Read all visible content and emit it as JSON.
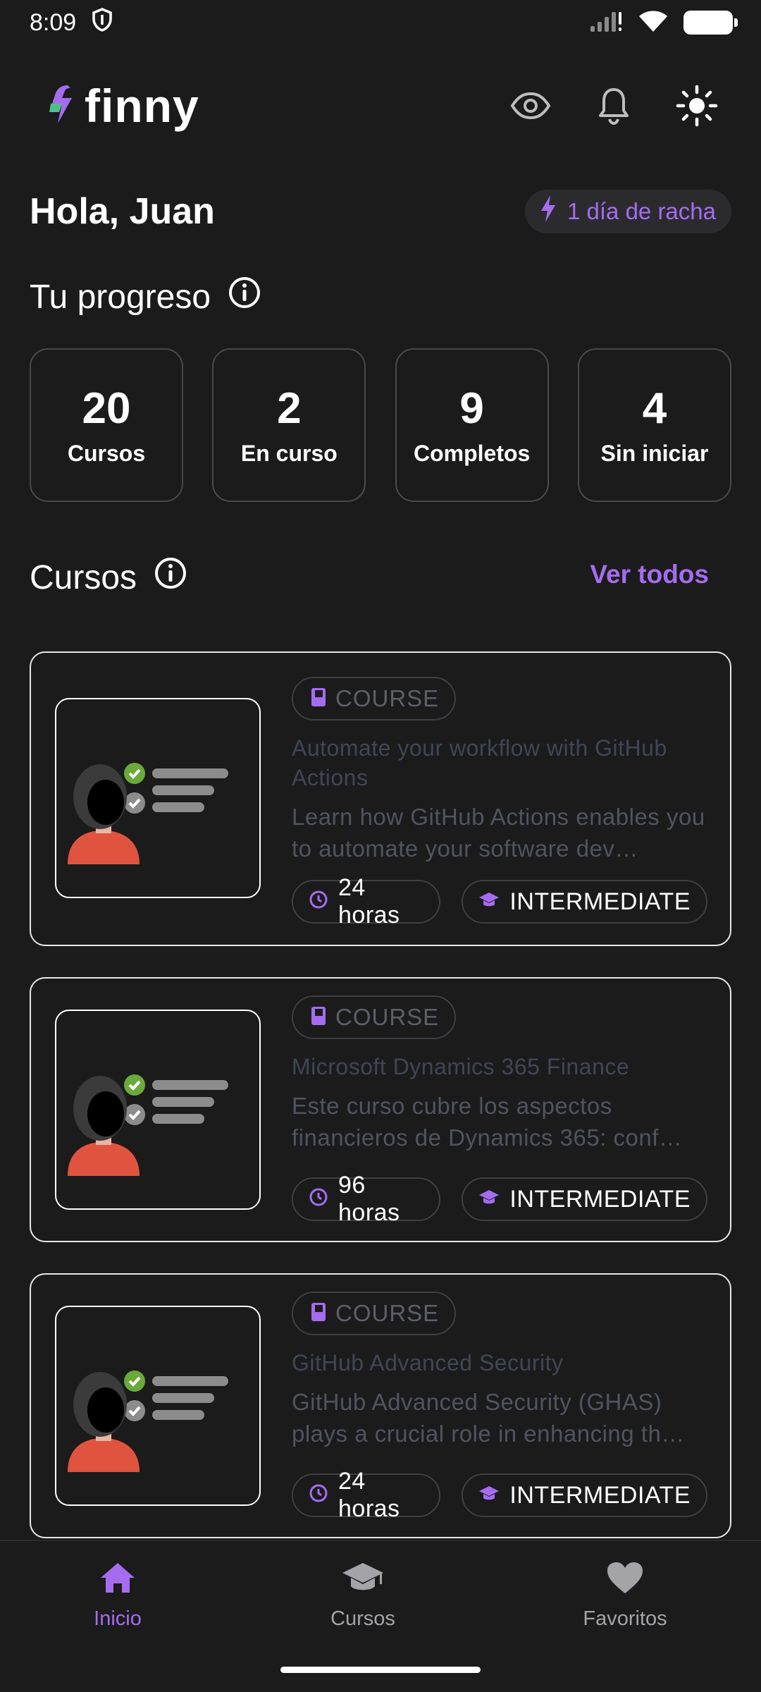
{
  "status_bar": {
    "time": "8:09"
  },
  "header": {
    "logo_text": "finny",
    "icons": [
      "eye-icon",
      "bell-icon",
      "sun-icon"
    ]
  },
  "greeting": {
    "text": "Hola, Juan",
    "streak": "1 día de racha"
  },
  "progress": {
    "title": "Tu progreso",
    "stats": [
      {
        "value": "20",
        "label": "Cursos"
      },
      {
        "value": "2",
        "label": "En curso"
      },
      {
        "value": "9",
        "label": "Completos"
      },
      {
        "value": "4",
        "label": "Sin iniciar"
      }
    ]
  },
  "courses": {
    "title": "Cursos",
    "see_all": "Ver todos",
    "items": [
      {
        "type": "COURSE",
        "title": "Automate your workflow with GitHub Actions",
        "description": "Learn how GitHub Actions enables you to automate your software dev…",
        "duration": "24 horas",
        "level": "INTERMEDIATE"
      },
      {
        "type": "COURSE",
        "title": "Microsoft Dynamics 365 Finance",
        "description": "Este curso cubre los aspectos financieros de Dynamics 365: conf…",
        "duration": "96 horas",
        "level": "INTERMEDIATE"
      },
      {
        "type": "COURSE",
        "title": "GitHub Advanced Security",
        "description": "GitHub Advanced Security (GHAS) plays a crucial role in enhancing th…",
        "duration": "24 horas",
        "level": "INTERMEDIATE"
      }
    ]
  },
  "bottom_nav": {
    "items": [
      {
        "label": "Inicio",
        "icon": "home-icon",
        "active": true
      },
      {
        "label": "Cursos",
        "icon": "graduation-cap-icon",
        "active": false
      },
      {
        "label": "Favoritos",
        "icon": "heart-icon",
        "active": false
      }
    ]
  },
  "colors": {
    "accent": "#a56cf0",
    "background": "#1b1b1c"
  }
}
